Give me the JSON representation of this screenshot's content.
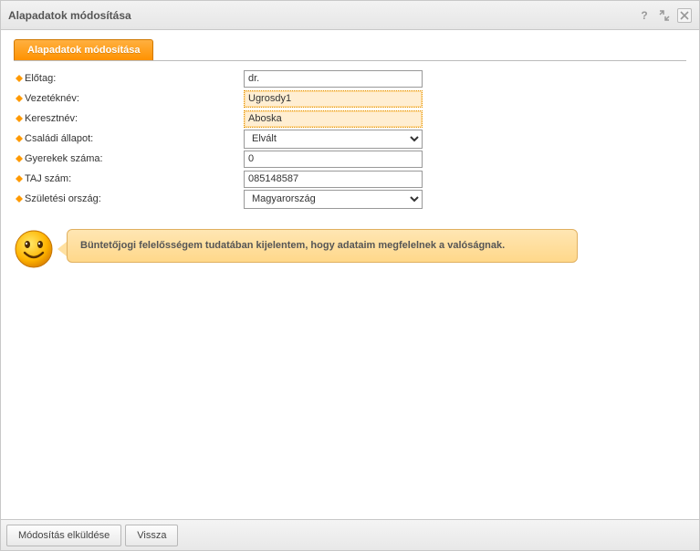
{
  "window": {
    "title": "Alapadatok módosítása"
  },
  "tab": {
    "label": "Alapadatok módosítása"
  },
  "fields": {
    "prefix": {
      "label": "Előtag:",
      "value": "dr."
    },
    "lastname": {
      "label": "Vezetéknév:",
      "value": "Ugrosdy1"
    },
    "firstname": {
      "label": "Keresztnév:",
      "value": "Aboska"
    },
    "marital": {
      "label": "Családi állapot:",
      "value": "Elvált"
    },
    "children": {
      "label": "Gyerekek száma:",
      "value": "0"
    },
    "taj": {
      "label": "TAJ szám:",
      "value": "085148587"
    },
    "birthcountry": {
      "label": "Születési ország:",
      "value": "Magyarország"
    }
  },
  "callout": {
    "text": "Büntetőjogi felelősségem tudatában kijelentem, hogy adataim megfelelnek a valóságnak."
  },
  "footer": {
    "submit": "Módosítás elküldése",
    "back": "Vissza"
  }
}
